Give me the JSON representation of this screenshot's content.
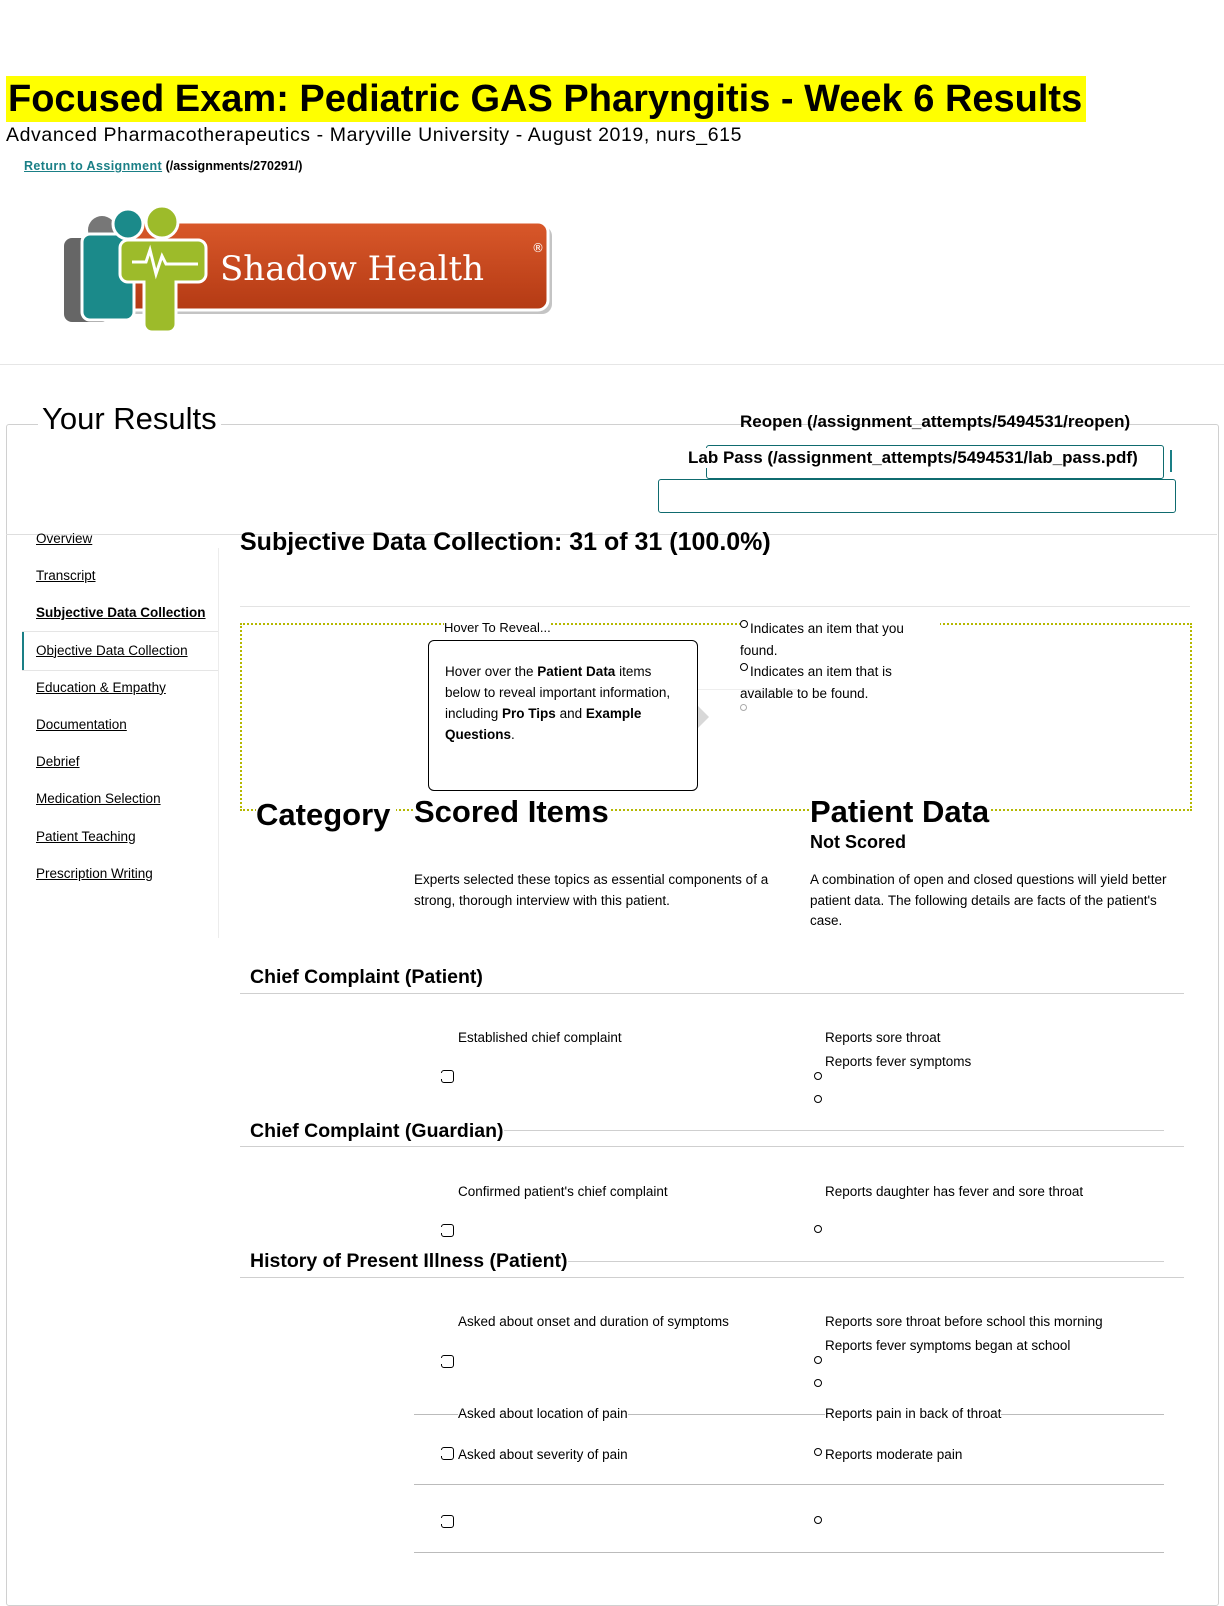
{
  "header": {
    "title": "Focused Exam: Pediatric GAS Pharyngitis - Week 6 Results",
    "subtitle": "Advanced Pharmacotherapeutics - Maryville University - August 2019, nurs_615",
    "return_label": "Return to Assignment",
    "return_path": "(/assignments/270291/)"
  },
  "logo": {
    "text": "Shadow Health",
    "colors": {
      "bg": "#c94a1f",
      "green": "#9dbb2a",
      "teal": "#1b8a8a"
    }
  },
  "results": {
    "heading": "Your Results",
    "reopen": "Reopen (/assignment_attempts/5494531/reopen)",
    "lab_pass": "Lab Pass (/assignment_attempts/5494531/lab_pass.pdf)"
  },
  "nav": {
    "items": [
      "Overview",
      "Transcript",
      "Subjective Data Collection",
      "Objective Data Collection",
      "Education & Empathy",
      "Documentation",
      "Debrief",
      "Medication Selection",
      "Patient Teaching",
      "Prescription Writing"
    ]
  },
  "section": {
    "title": "Subjective Data Collection: 31 of 31 (100.0%)",
    "hover_label": "Hover To Reveal...",
    "tooltip": {
      "t1": "Hover over the ",
      "b1": "Patient Data",
      "t2": " items below to reveal important information, including ",
      "b2": "Pro Tips",
      "t3": " and ",
      "b3": "Example Questions",
      "t4": "."
    },
    "legend_found": "Indicates an item that you found.",
    "legend_available": "Indicates an item that is available to be found."
  },
  "columns": {
    "category": "Category",
    "scored": "Scored Items",
    "scored_desc": "Experts selected these topics as essential components of a strong, thorough interview with this patient.",
    "patient": "Patient Data",
    "not_scored": "Not Scored",
    "patient_desc": "A combination of open and closed questions will yield better patient data. The following details are facts of the patient's case."
  },
  "categories": {
    "c1": {
      "title": "Chief Complaint (Patient)",
      "item": "Established chief complaint",
      "data": [
        "Reports sore throat",
        "Reports fever symptoms"
      ]
    },
    "c2": {
      "title": "Chief Complaint (Guardian)",
      "item": "Confirmed patient's chief complaint",
      "data": [
        "Reports daughter has fever and sore throat"
      ]
    },
    "c3": {
      "title": "History of Present Illness (Patient)",
      "items": [
        {
          "item": "Asked about onset and duration of symptoms",
          "data": [
            "Reports sore throat before school this morning",
            "Reports fever symptoms began at school"
          ]
        },
        {
          "item": "Asked about location of pain",
          "data": [
            "Reports pain in back of throat"
          ]
        },
        {
          "item": "Asked about severity of pain",
          "data": [
            "Reports moderate pain"
          ]
        }
      ]
    }
  }
}
